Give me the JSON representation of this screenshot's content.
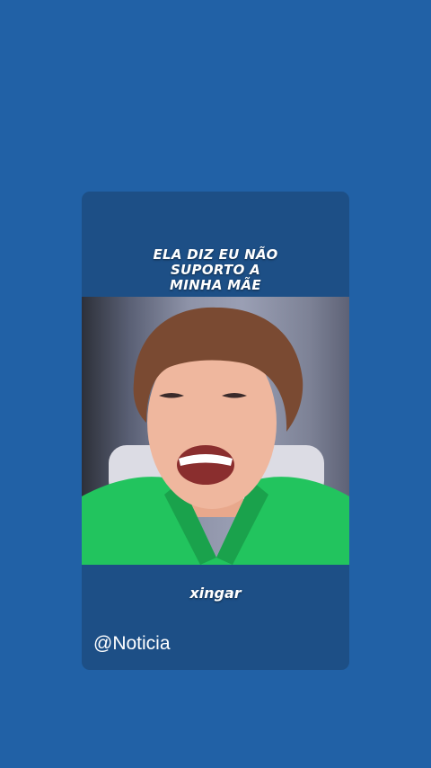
{
  "post": {
    "caption_top_lines": [
      "ELA DIZ EU NÃO",
      "SUPORTO A",
      "MINHA MÃE"
    ],
    "caption_bottom": "xingar",
    "handle": "@Noticia"
  },
  "colors": {
    "background": "#2161a6",
    "card": "#1d4f86",
    "text": "#ffffff",
    "jacket": "#22c45e",
    "hair": "#7a4a32"
  }
}
